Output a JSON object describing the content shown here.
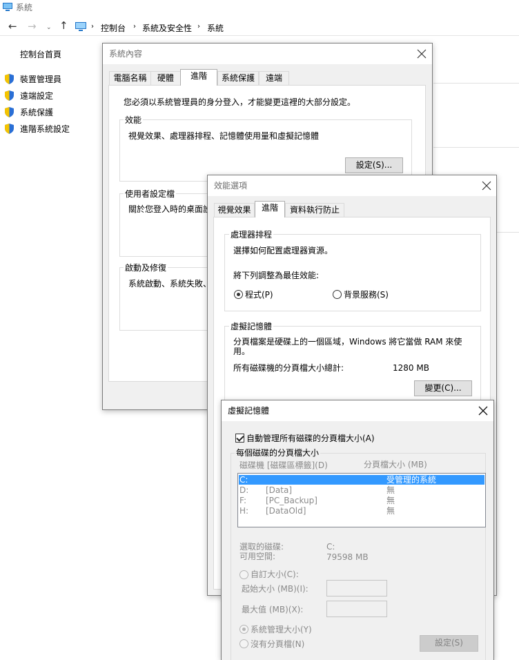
{
  "explorer": {
    "window_title": "系統",
    "breadcrumb": [
      "控制台",
      "系統及安全性",
      "系統"
    ],
    "sidebar": {
      "home": "控制台首頁",
      "items": [
        "裝置管理員",
        "遠端設定",
        "系統保護",
        "進階系統設定"
      ]
    }
  },
  "sysprops": {
    "title": "系統內容",
    "tabs": [
      "電腦名稱",
      "硬體",
      "進階",
      "系統保護",
      "遠端"
    ],
    "admin_note": "您必須以系統管理員的身分登入，才能變更這裡的大部分設定。",
    "perf_label": "效能",
    "perf_desc": "視覺效果、處理器排程、記憶體使用量和虛擬記憶體",
    "perf_button": "設定(S)...",
    "profile_label": "使用者設定檔",
    "profile_desc": "關於您登入時的桌面設",
    "startup_label": "啟動及修復",
    "startup_desc": "系統啟動、系統失敗、"
  },
  "perfopts": {
    "title": "效能選項",
    "tabs": [
      "視覺效果",
      "進階",
      "資料執行防止"
    ],
    "sched_label": "處理器排程",
    "sched_desc": "選擇如何配置處理器資源。",
    "adjust_label": "將下列調整為最佳效能:",
    "radio_programs": "程式(P)",
    "radio_background": "背景服務(S)",
    "vm_label": "虛擬記憶體",
    "vm_desc": "分頁檔案是硬碟上的一個區域，Windows 將它當做 RAM 來使用。",
    "vm_total_label": "所有磁碟機的分頁檔大小總計:",
    "vm_total_value": "1280 MB",
    "change_button": "變更(C)..."
  },
  "vmem": {
    "title": "虛擬記憶體",
    "auto_manage": "自動管理所有磁碟的分頁檔大小(A)",
    "group_label": "每個磁碟的分頁檔大小",
    "col_drive": "磁碟機 [磁碟區標籤](D)",
    "col_size": "分頁檔大小 (MB)",
    "drives": [
      {
        "letter": "C:",
        "label": "",
        "size": "受管理的系統"
      },
      {
        "letter": "D:",
        "label": "[Data]",
        "size": "無"
      },
      {
        "letter": "F:",
        "label": "[PC_Backup]",
        "size": "無"
      },
      {
        "letter": "H:",
        "label": "[DataOld]",
        "size": "無"
      }
    ],
    "selected_drive_label": "選取的磁碟:",
    "selected_drive_value": "C:",
    "free_space_label": "可用空間:",
    "free_space_value": "79598 MB",
    "custom_size": "自訂大小(C):",
    "initial_size": "起始大小 (MB)(I):",
    "max_size": "最大值 (MB)(X):",
    "system_managed": "系統管理大小(Y)",
    "no_paging": "沒有分頁檔(N)",
    "set_button": "設定(S)"
  }
}
